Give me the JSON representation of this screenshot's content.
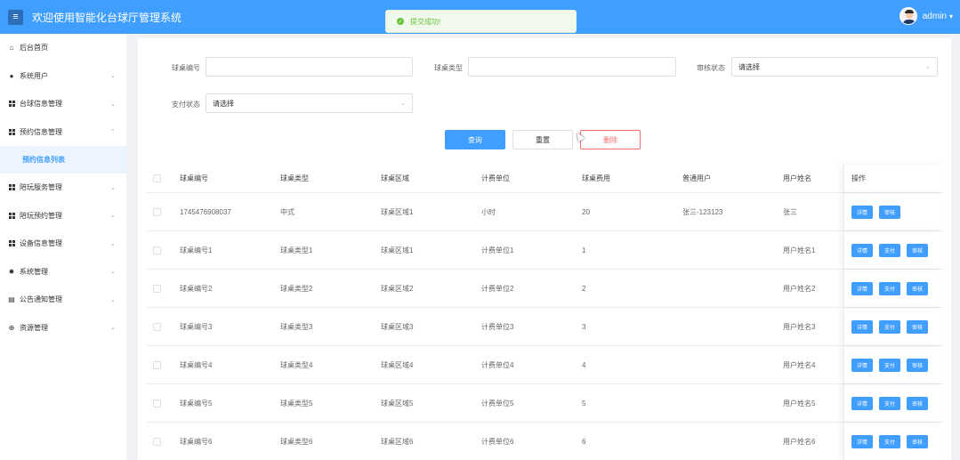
{
  "header": {
    "menu_icon": "menu-icon",
    "title": "欢迎使用智能化台球厅管理系统",
    "username": "admin",
    "username_caret": "▾"
  },
  "toast": {
    "icon": "check-circle-icon",
    "message": "提交成功!",
    "color": "#67c23a"
  },
  "sidebar": {
    "items": [
      {
        "label": "后台首页",
        "icon": "home-icon"
      },
      {
        "label": "系统用户",
        "icon": "user-icon"
      },
      {
        "label": "台球信息管理",
        "icon": "grid-icon"
      },
      {
        "label": "预约信息管理",
        "icon": "grid-icon"
      },
      {
        "label": "陪玩服务管理",
        "icon": "grid-icon"
      },
      {
        "label": "陪玩预约管理",
        "icon": "grid-icon"
      },
      {
        "label": "设备信息管理",
        "icon": "grid-icon"
      },
      {
        "label": "系统管理",
        "icon": "gear-icon"
      },
      {
        "label": "公告通知管理",
        "icon": "document-icon"
      },
      {
        "label": "资源管理",
        "icon": "plus-circle-icon"
      }
    ],
    "active_sub": "预约信息列表"
  },
  "search": {
    "table_no_label": "球桌编号",
    "table_type_label": "球桌类型",
    "audit_status_label": "审核状态",
    "audit_status_value": "请选择",
    "pay_status_label": "支付状态",
    "pay_status_value": "请选择"
  },
  "buttons": {
    "query": "查询",
    "reset": "重置",
    "delete": "删除"
  },
  "table": {
    "headers": [
      "球桌编号",
      "球桌类型",
      "球桌区域",
      "计费单位",
      "球桌费用",
      "普通用户",
      "用户姓名",
      "操作"
    ],
    "actions": {
      "detail": "详情",
      "pay": "支付",
      "audit": "审核"
    },
    "rows": [
      {
        "no": "1745476908037",
        "type": "中式",
        "area": "球桌区域1",
        "unit": "小时",
        "fee": "20",
        "user": "张三-123123",
        "name": "张三",
        "paid": true
      },
      {
        "no": "球桌编号1",
        "type": "球桌类型1",
        "area": "球桌区域1",
        "unit": "计费单位1",
        "fee": "1",
        "user": "",
        "name": "用户姓名1",
        "paid": false
      },
      {
        "no": "球桌编号2",
        "type": "球桌类型2",
        "area": "球桌区域2",
        "unit": "计费单位2",
        "fee": "2",
        "user": "",
        "name": "用户姓名2",
        "paid": false
      },
      {
        "no": "球桌编号3",
        "type": "球桌类型3",
        "area": "球桌区域3",
        "unit": "计费单位3",
        "fee": "3",
        "user": "",
        "name": "用户姓名3",
        "paid": false
      },
      {
        "no": "球桌编号4",
        "type": "球桌类型4",
        "area": "球桌区域4",
        "unit": "计费单位4",
        "fee": "4",
        "user": "",
        "name": "用户姓名4",
        "paid": false
      },
      {
        "no": "球桌编号5",
        "type": "球桌类型5",
        "area": "球桌区域5",
        "unit": "计费单位5",
        "fee": "5",
        "user": "",
        "name": "用户姓名5",
        "paid": false
      },
      {
        "no": "球桌编号6",
        "type": "球桌类型6",
        "area": "球桌区域6",
        "unit": "计费单位6",
        "fee": "6",
        "user": "",
        "name": "用户姓名6",
        "paid": false
      }
    ]
  },
  "colors": {
    "primary": "#409eff",
    "danger": "#f56c6c",
    "success": "#67c23a"
  }
}
